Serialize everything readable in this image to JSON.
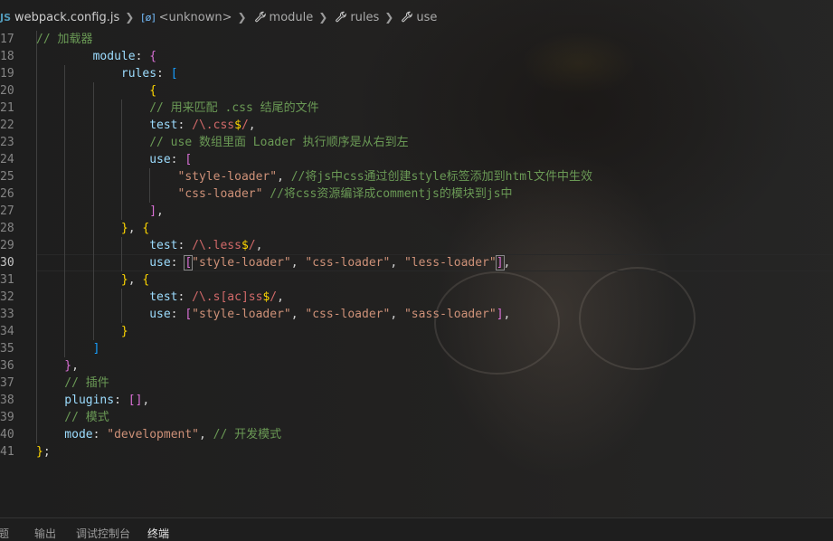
{
  "breadcrumb": {
    "file": "webpack.config.js",
    "items": [
      {
        "label": "<unknown>",
        "icon": "symbol-icon"
      },
      {
        "label": "module",
        "icon": "wrench-icon"
      },
      {
        "label": "rules",
        "icon": "wrench-icon"
      },
      {
        "label": "use",
        "icon": "wrench-icon"
      }
    ]
  },
  "editor": {
    "current_line": 30,
    "lines": [
      {
        "n": "17",
        "guides": [
          1
        ],
        "tokens": [
          [
            "cm",
            "// 加载器"
          ]
        ]
      },
      {
        "n": "18",
        "guides": [
          1
        ],
        "tokens": [
          [
            "pr",
            "module"
          ],
          [
            "pu",
            ": "
          ],
          [
            "b2",
            "{"
          ]
        ]
      },
      {
        "n": "19",
        "guides": [
          1,
          2
        ],
        "tokens": [
          [
            "pr",
            "rules"
          ],
          [
            "pu",
            ": "
          ],
          [
            "b3",
            "["
          ]
        ]
      },
      {
        "n": "20",
        "guides": [
          1,
          2,
          3
        ],
        "tokens": [
          [
            "b1",
            "{"
          ]
        ]
      },
      {
        "n": "21",
        "guides": [
          1,
          2,
          3,
          4
        ],
        "tokens": [
          [
            "cm",
            "// 用来匹配 .css 结尾的文件"
          ]
        ]
      },
      {
        "n": "22",
        "guides": [
          1,
          2,
          3,
          4
        ],
        "tokens": [
          [
            "pr",
            "test"
          ],
          [
            "pu",
            ": "
          ],
          [
            "rx",
            "/\\.css"
          ],
          [
            "b1",
            "$"
          ],
          [
            "rx",
            "/"
          ],
          [
            "pu",
            ","
          ]
        ]
      },
      {
        "n": "23",
        "guides": [
          1,
          2,
          3,
          4
        ],
        "tokens": [
          [
            "cm",
            "// use 数组里面 Loader 执行顺序是从右到左"
          ]
        ]
      },
      {
        "n": "24",
        "guides": [
          1,
          2,
          3,
          4
        ],
        "tokens": [
          [
            "pr",
            "use"
          ],
          [
            "pu",
            ": "
          ],
          [
            "b2",
            "["
          ]
        ]
      },
      {
        "n": "25",
        "guides": [
          1,
          2,
          3,
          4,
          5
        ],
        "tokens": [
          [
            "st",
            "\"style-loader\""
          ],
          [
            "pu",
            ", "
          ],
          [
            "cm",
            "//将js中css通过创建style标签添加到html文件中生效"
          ]
        ]
      },
      {
        "n": "26",
        "guides": [
          1,
          2,
          3,
          4,
          5
        ],
        "tokens": [
          [
            "st",
            "\"css-loader\""
          ],
          [
            "pu",
            " "
          ],
          [
            "cm",
            "//将css资源编译成commentjs的模块到js中"
          ]
        ]
      },
      {
        "n": "27",
        "guides": [
          1,
          2,
          3,
          4
        ],
        "tokens": [
          [
            "b2",
            "]"
          ],
          [
            "pu",
            ","
          ]
        ]
      },
      {
        "n": "28",
        "guides": [
          1,
          2,
          3
        ],
        "tokens": [
          [
            "b1",
            "}"
          ],
          [
            "pu",
            ", "
          ],
          [
            "b1",
            "{"
          ]
        ]
      },
      {
        "n": "29",
        "guides": [
          1,
          2,
          3,
          4
        ],
        "tokens": [
          [
            "pr",
            "test"
          ],
          [
            "pu",
            ": "
          ],
          [
            "rx",
            "/\\.less"
          ],
          [
            "b1",
            "$"
          ],
          [
            "rx",
            "/"
          ],
          [
            "pu",
            ","
          ]
        ]
      },
      {
        "n": "30",
        "guides": [
          1,
          2,
          3,
          4
        ],
        "tokens": [
          [
            "pr",
            "use"
          ],
          [
            "pu",
            ": "
          ],
          [
            "b2m",
            "["
          ],
          [
            "st",
            "\"style-loader\""
          ],
          [
            "pu",
            ", "
          ],
          [
            "st",
            "\"css-loader\""
          ],
          [
            "pu",
            ", "
          ],
          [
            "st",
            "\"less-loader\""
          ],
          [
            "b2m",
            "]"
          ],
          [
            "pu",
            ","
          ]
        ]
      },
      {
        "n": "31",
        "guides": [
          1,
          2,
          3
        ],
        "tokens": [
          [
            "b1",
            "}"
          ],
          [
            "pu",
            ", "
          ],
          [
            "b1",
            "{"
          ]
        ]
      },
      {
        "n": "32",
        "guides": [
          1,
          2,
          3,
          4
        ],
        "tokens": [
          [
            "pr",
            "test"
          ],
          [
            "pu",
            ": "
          ],
          [
            "rx",
            "/\\.s[ac]ss"
          ],
          [
            "b1",
            "$"
          ],
          [
            "rx",
            "/"
          ],
          [
            "pu",
            ","
          ]
        ]
      },
      {
        "n": "33",
        "guides": [
          1,
          2,
          3,
          4
        ],
        "tokens": [
          [
            "pr",
            "use"
          ],
          [
            "pu",
            ": "
          ],
          [
            "b2",
            "["
          ],
          [
            "st",
            "\"style-loader\""
          ],
          [
            "pu",
            ", "
          ],
          [
            "st",
            "\"css-loader\""
          ],
          [
            "pu",
            ", "
          ],
          [
            "st",
            "\"sass-loader\""
          ],
          [
            "b2",
            "]"
          ],
          [
            "pu",
            ","
          ]
        ]
      },
      {
        "n": "34",
        "guides": [
          1,
          2,
          3
        ],
        "tokens": [
          [
            "b1",
            "}"
          ]
        ]
      },
      {
        "n": "35",
        "guides": [
          1,
          2
        ],
        "tokens": [
          [
            "b3",
            "]"
          ]
        ]
      },
      {
        "n": "36",
        "guides": [
          1
        ],
        "tokens": [
          [
            "b2",
            "}"
          ],
          [
            "pu",
            ","
          ]
        ]
      },
      {
        "n": "37",
        "guides": [
          1
        ],
        "tokens": [
          [
            "cm",
            "// 插件"
          ]
        ]
      },
      {
        "n": "38",
        "guides": [
          1
        ],
        "tokens": [
          [
            "pr",
            "plugins"
          ],
          [
            "pu",
            ": "
          ],
          [
            "b2",
            "[]"
          ],
          [
            "pu",
            ","
          ]
        ]
      },
      {
        "n": "39",
        "guides": [
          1
        ],
        "tokens": [
          [
            "cm",
            "// 模式"
          ]
        ]
      },
      {
        "n": "40",
        "guides": [
          1
        ],
        "tokens": [
          [
            "pr",
            "mode"
          ],
          [
            "pu",
            ": "
          ],
          [
            "st",
            "\"development\""
          ],
          [
            "pu",
            ", "
          ],
          [
            "cm",
            "// 开发模式"
          ]
        ]
      },
      {
        "n": "41",
        "guides": [],
        "tokens": [
          [
            "b1",
            "}"
          ],
          [
            "pu",
            ";"
          ]
        ]
      }
    ]
  },
  "indent_code": [
    0,
    2,
    3,
    4,
    4,
    4,
    4,
    4,
    5,
    5,
    4,
    3,
    4,
    4,
    3,
    4,
    4,
    3,
    2,
    1,
    1,
    1,
    1,
    1,
    0
  ],
  "panel": {
    "tabs": [
      "问题",
      "输出",
      "调试控制台",
      "终端"
    ],
    "active_tab": "终端"
  },
  "colors": {
    "comment": "#6a9955",
    "property": "#9cdcfe",
    "string": "#ce9178",
    "regex": "#d16969",
    "bracket1": "#ffd700",
    "bracket2": "#da70d6",
    "bracket3": "#179fff"
  }
}
